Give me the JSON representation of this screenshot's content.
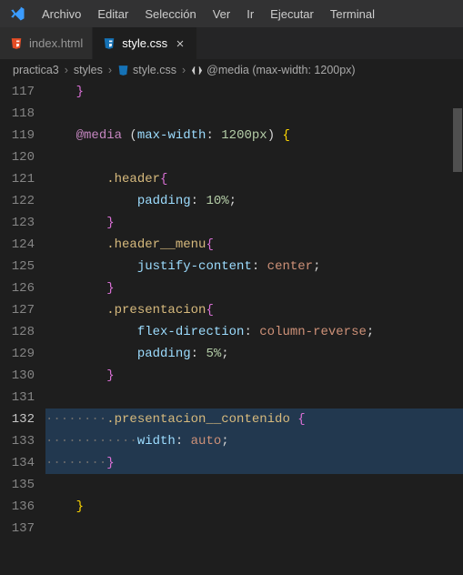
{
  "menubar": {
    "items": [
      "Archivo",
      "Editar",
      "Selección",
      "Ver",
      "Ir",
      "Ejecutar",
      "Terminal"
    ]
  },
  "tabs": [
    {
      "icon": "html",
      "label": "index.html",
      "active": false,
      "closeable": false
    },
    {
      "icon": "css",
      "label": "style.css",
      "active": true,
      "closeable": true
    }
  ],
  "breadcrumbs": {
    "items": [
      {
        "icon": null,
        "label": "practica3"
      },
      {
        "icon": null,
        "label": "styles"
      },
      {
        "icon": "css",
        "label": "style.css"
      },
      {
        "icon": "symbol",
        "label": "@media (max-width: 1200px)"
      }
    ]
  },
  "editor": {
    "firstLine": 117,
    "currentLine": 132,
    "lines": [
      {
        "n": 117,
        "indent": 1,
        "tokens": [
          [
            "brace2",
            "}"
          ]
        ]
      },
      {
        "n": 118,
        "indent": 0,
        "tokens": []
      },
      {
        "n": 119,
        "indent": 1,
        "tokens": [
          [
            "at",
            "@media"
          ],
          [
            "punc",
            " ("
          ],
          [
            "prop",
            "max-width"
          ],
          [
            "punc",
            ": "
          ],
          [
            "num",
            "1200px"
          ],
          [
            "punc",
            ") "
          ],
          [
            "brace",
            "{"
          ]
        ]
      },
      {
        "n": 120,
        "indent": 1,
        "tokens": []
      },
      {
        "n": 121,
        "indent": 2,
        "tokens": [
          [
            "sel",
            ".header"
          ],
          [
            "brace2",
            "{"
          ]
        ]
      },
      {
        "n": 122,
        "indent": 3,
        "tokens": [
          [
            "prop",
            "padding"
          ],
          [
            "punc",
            ": "
          ],
          [
            "num",
            "10%"
          ],
          [
            "punc",
            ";"
          ]
        ]
      },
      {
        "n": 123,
        "indent": 2,
        "tokens": [
          [
            "brace2",
            "}"
          ]
        ]
      },
      {
        "n": 124,
        "indent": 2,
        "tokens": [
          [
            "sel",
            ".header__menu"
          ],
          [
            "brace2",
            "{"
          ]
        ]
      },
      {
        "n": 125,
        "indent": 3,
        "tokens": [
          [
            "prop",
            "justify-content"
          ],
          [
            "punc",
            ": "
          ],
          [
            "val",
            "center"
          ],
          [
            "punc",
            ";"
          ]
        ]
      },
      {
        "n": 126,
        "indent": 2,
        "tokens": [
          [
            "brace2",
            "}"
          ]
        ]
      },
      {
        "n": 127,
        "indent": 2,
        "tokens": [
          [
            "sel",
            ".presentacion"
          ],
          [
            "brace2",
            "{"
          ]
        ]
      },
      {
        "n": 128,
        "indent": 3,
        "tokens": [
          [
            "prop",
            "flex-direction"
          ],
          [
            "punc",
            ": "
          ],
          [
            "val",
            "column-reverse"
          ],
          [
            "punc",
            ";"
          ]
        ]
      },
      {
        "n": 129,
        "indent": 3,
        "tokens": [
          [
            "prop",
            "padding"
          ],
          [
            "punc",
            ": "
          ],
          [
            "num",
            "5%"
          ],
          [
            "punc",
            ";"
          ]
        ]
      },
      {
        "n": 130,
        "indent": 2,
        "tokens": [
          [
            "brace2",
            "}"
          ]
        ]
      },
      {
        "n": 131,
        "indent": 0,
        "tokens": []
      },
      {
        "n": 132,
        "indent": 2,
        "hl": true,
        "ws": true,
        "tokens": [
          [
            "sel",
            ".presentacion__contenido"
          ],
          [
            "punc",
            " "
          ],
          [
            "brace2",
            "{"
          ]
        ]
      },
      {
        "n": 133,
        "indent": 3,
        "hl": true,
        "ws": true,
        "tokens": [
          [
            "prop",
            "width"
          ],
          [
            "punc",
            ": "
          ],
          [
            "val",
            "auto"
          ],
          [
            "punc",
            ";"
          ]
        ]
      },
      {
        "n": 134,
        "indent": 2,
        "hl": true,
        "ws": true,
        "hllast": true,
        "tokens": [
          [
            "brace2",
            "}"
          ]
        ]
      },
      {
        "n": 135,
        "indent": 0,
        "tokens": []
      },
      {
        "n": 136,
        "indent": 1,
        "tokens": [
          [
            "brace",
            "}"
          ]
        ]
      },
      {
        "n": 137,
        "indent": 0,
        "tokens": []
      }
    ]
  }
}
